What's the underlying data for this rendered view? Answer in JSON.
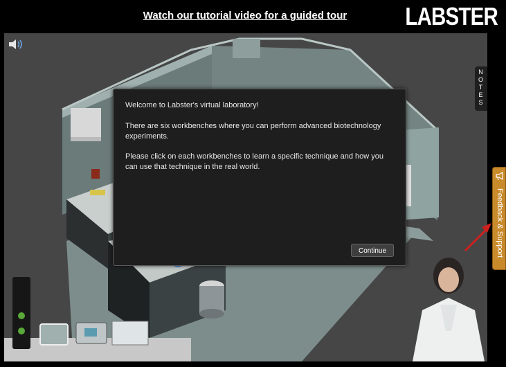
{
  "header": {
    "tutorial_link": "Watch our tutorial video for a guided tour",
    "logo": "LABSTER"
  },
  "dialog": {
    "paragraphs": [
      "Welcome to Labster's virtual laboratory!",
      "There are six workbenches where you can perform advanced biotechnology experiments.",
      "Please click on each workbenches to learn a specific technique and how you can use that technique in the real world."
    ],
    "continue_label": "Continue"
  },
  "side_tabs": {
    "notes_letters": [
      "N",
      "O",
      "T",
      "E",
      "S"
    ],
    "feedback_label": "Feedback & Support"
  },
  "icons": {
    "sound": "speaker-icon",
    "feedback": "megaphone-icon"
  },
  "colors": {
    "feedback_tab": "#c88a2a",
    "viewport_bg": "#464646",
    "dialog_bg": "#1e1e1e",
    "arrow": "#d0201e"
  }
}
